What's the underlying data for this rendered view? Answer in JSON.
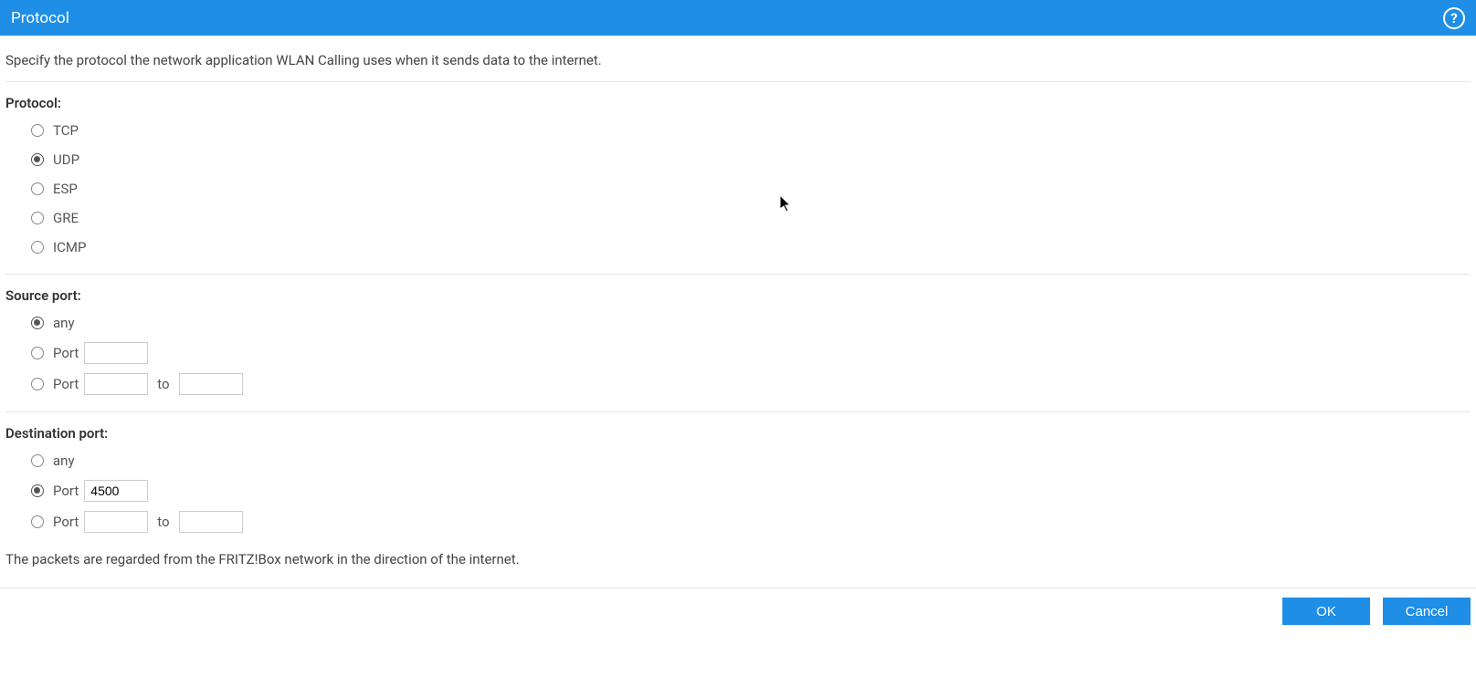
{
  "header": {
    "title": "Protocol",
    "help": "?"
  },
  "intro": "Specify the protocol the network application WLAN Calling uses when it sends data to the internet.",
  "protocol": {
    "label": "Protocol:",
    "options": {
      "tcp": "TCP",
      "udp": "UDP",
      "esp": "ESP",
      "gre": "GRE",
      "icmp": "ICMP"
    },
    "selected": "udp"
  },
  "source_port": {
    "label": "Source port:",
    "any": "any",
    "port": "Port",
    "to": "to",
    "selected": "any",
    "single_value": "",
    "range_from": "",
    "range_to": ""
  },
  "dest_port": {
    "label": "Destination port:",
    "any": "any",
    "port": "Port",
    "to": "to",
    "selected": "single",
    "single_value": "4500",
    "range_from": "",
    "range_to": ""
  },
  "note": "The packets are regarded from the FRITZ!Box network in the direction of the internet.",
  "footer": {
    "ok": "OK",
    "cancel": "Cancel"
  }
}
